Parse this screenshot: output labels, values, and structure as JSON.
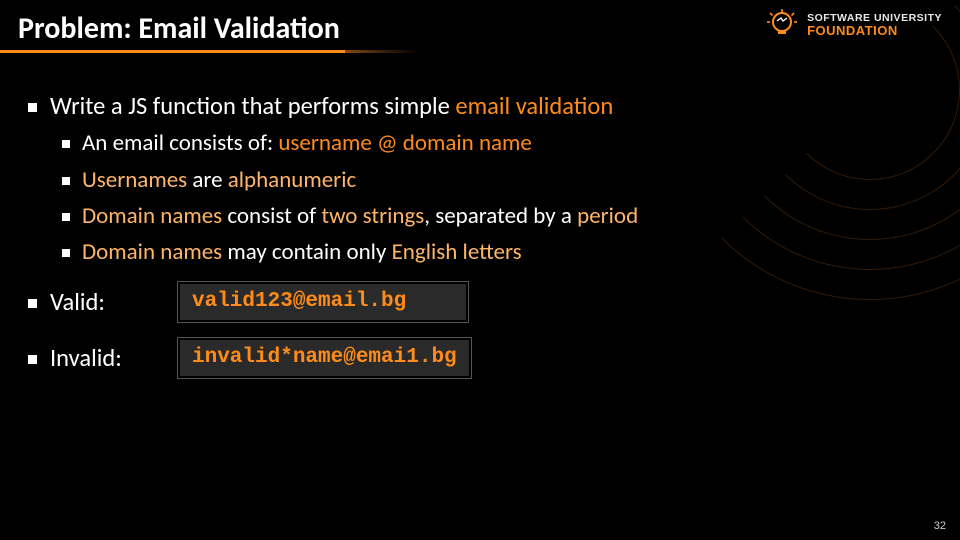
{
  "title": "Problem: Email Validation",
  "logo": {
    "line1": "SOFTWARE UNIVERSITY",
    "line2": "FOUNDATION"
  },
  "bullets": {
    "main": {
      "pre": "Write a JS function that performs simple ",
      "hl": "email validation"
    },
    "sub1": {
      "pre": "An email consists of: ",
      "u": "username",
      "at": " @ ",
      "d": "domain name"
    },
    "sub2": {
      "a": "Usernames",
      "b": " are ",
      "c": "alphanumeric"
    },
    "sub3": {
      "a": "Domain names",
      "b": " consist of ",
      "c": "two strings",
      "d": ", separated by a ",
      "e": "period"
    },
    "sub4": {
      "a": "Domain names",
      "b": " may contain only ",
      "c": "English letters"
    }
  },
  "examples": {
    "valid": {
      "label": "Valid:",
      "code": "valid123@email.bg"
    },
    "invalid": {
      "label": "Invalid:",
      "code": "invalid*name@emai1.bg"
    }
  },
  "page": "32"
}
